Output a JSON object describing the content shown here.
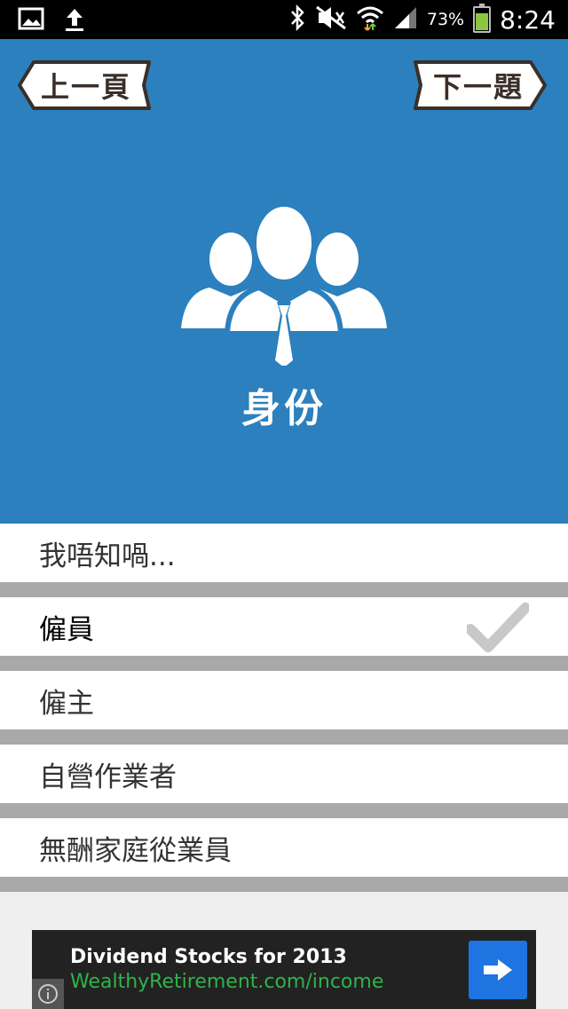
{
  "status_bar": {
    "time": "8:24",
    "battery_percent": "73%",
    "battery_level": 0.73,
    "icons": [
      "gallery-icon",
      "upload-icon",
      "bluetooth-icon",
      "mute-icon",
      "wifi-icon",
      "signal-icon",
      "battery-icon"
    ]
  },
  "header": {
    "prev_label": "上一頁",
    "next_label": "下一題",
    "title": "身份",
    "icon": "people-icon",
    "background": "#2b80bd"
  },
  "options": [
    {
      "label": "我唔知喎...",
      "selected": false
    },
    {
      "label": "僱員",
      "selected": true
    },
    {
      "label": "僱主",
      "selected": false
    },
    {
      "label": "自營作業者",
      "selected": false
    },
    {
      "label": "無酬家庭從業員",
      "selected": false
    }
  ],
  "ad": {
    "title": "Dividend Stocks for 2013",
    "url": "WealthyRetirement.com/income",
    "url_color": "#2fb34a",
    "button_color": "#1e74e0"
  }
}
